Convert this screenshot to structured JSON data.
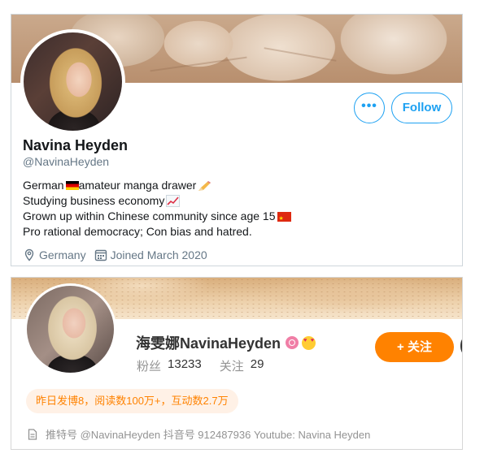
{
  "twitter": {
    "name": "Navina Heyden",
    "handle": "@NavinaHeyden",
    "bio": {
      "line1": "German",
      "line1b": " amateur manga drawer",
      "line2": "Studying business economy",
      "line3": "Grown up within Chinese community since age 15",
      "line4": "Pro rational democracy; Con bias and hatred."
    },
    "more_label": "•••",
    "follow_label": "Follow",
    "location": "Germany",
    "joined": "Joined March 2020",
    "accent_color": "#1da1f2"
  },
  "weibo": {
    "name": "海雯娜NavinaHeyden",
    "fans_label": "粉丝",
    "fans_count": "13233",
    "following_label": "关注",
    "following_count": "29",
    "follow_label": "+ 关注",
    "activity": "昨日发博8，阅读数100万+，互动数2.7万",
    "footer": "推特号 @NavinaHeyden 抖音号 912487936 Youtube: Navina Heyden",
    "accent_color": "#ff8200"
  }
}
